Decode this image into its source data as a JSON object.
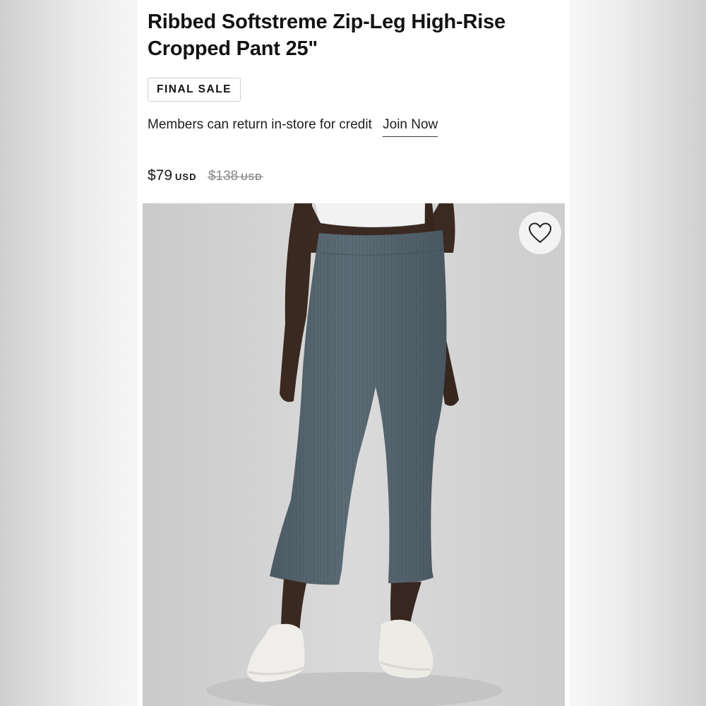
{
  "product": {
    "title": "Ribbed Softstreme Zip-Leg High-Rise Cropped Pant 25\"",
    "badge": "FINAL SALE",
    "membership_note": "Members can return in-store for credit",
    "join_link": "Join Now",
    "price": {
      "current": "$79",
      "current_currency": "USD",
      "original": "$138",
      "original_currency": "USD"
    },
    "image": {
      "description_icon": "product-photo",
      "wishlist_icon": "heart-icon"
    }
  },
  "colors": {
    "pant": "#56666f",
    "background": "#d5d5d5",
    "text": "#1a1a1a",
    "strikethrough": "#8a8a8a"
  }
}
